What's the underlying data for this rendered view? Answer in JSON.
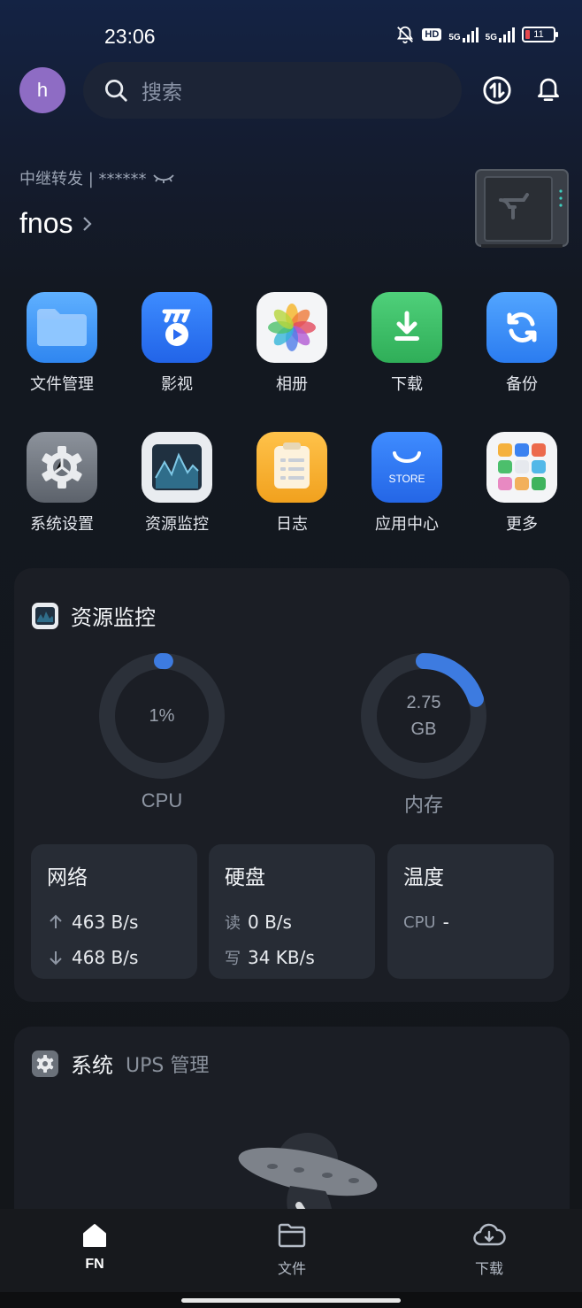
{
  "status_bar": {
    "time": "23:06",
    "hd_label": "HD",
    "net1": "5G",
    "net2": "5G",
    "battery": "11",
    "battery_color": "#e5484d"
  },
  "top": {
    "avatar_letter": "h",
    "search_placeholder": "搜索",
    "avatar_color": "#8e6cc4"
  },
  "device": {
    "relay_label": "中继转发 | ******",
    "name": "fnos"
  },
  "apps": [
    {
      "label": "文件管理",
      "icon": "folder-icon"
    },
    {
      "label": "影视",
      "icon": "video-icon"
    },
    {
      "label": "相册",
      "icon": "photos-icon"
    },
    {
      "label": "下载",
      "icon": "download-icon"
    },
    {
      "label": "备份",
      "icon": "backup-icon"
    },
    {
      "label": "系统设置",
      "icon": "settings-icon"
    },
    {
      "label": "资源监控",
      "icon": "monitor-icon"
    },
    {
      "label": "日志",
      "icon": "log-icon"
    },
    {
      "label": "应用中心",
      "icon": "store-icon",
      "badge": "STORE"
    },
    {
      "label": "更多",
      "icon": "more-apps-icon"
    }
  ],
  "monitor": {
    "title": "资源监控",
    "cpu": {
      "value": "1%",
      "label": "CPU",
      "fraction": 0.01
    },
    "memory": {
      "value": "2.75",
      "unit": "GB",
      "label": "内存",
      "fraction": 0.2
    },
    "accent": "#3d7be0",
    "network": {
      "title": "网络",
      "up": "463 B/s",
      "down": "468 B/s"
    },
    "disk": {
      "title": "硬盘",
      "read_key": "读",
      "read": "0 B/s",
      "write_key": "写",
      "write": "34 KB/s"
    },
    "temp": {
      "title": "温度",
      "cpu_key": "CPU",
      "cpu_value": "-"
    }
  },
  "system": {
    "title": "系统",
    "subtitle": "UPS 管理"
  },
  "nav": {
    "fn": "FN",
    "files": "文件",
    "download": "下载"
  }
}
